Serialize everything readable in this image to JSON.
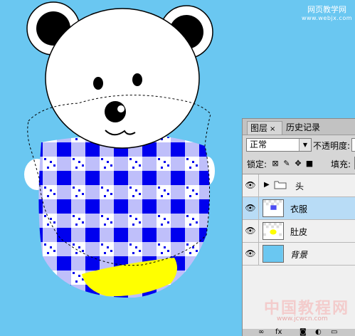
{
  "watermark_top": {
    "title": "网页教学网",
    "url": "www.webjx.com"
  },
  "watermark_bottom": {
    "cn": "中国教程网",
    "url": "www.jcwcn.com"
  },
  "panel": {
    "tabs": [
      {
        "label": "图层",
        "close": "×"
      },
      {
        "label": "历史记录"
      }
    ],
    "blend_mode": "正常",
    "opacity_label": "不透明度:",
    "lock_label": "锁定:",
    "fill_label": "填充:",
    "layers": [
      {
        "name": "头",
        "type": "group",
        "selected": false
      },
      {
        "name": "衣服",
        "type": "layer",
        "selected": true
      },
      {
        "name": "肚皮",
        "type": "layer",
        "selected": false
      },
      {
        "name": "背景",
        "type": "layer",
        "selected": false
      }
    ]
  },
  "colors": {
    "canvas_bg": "#6ac7f1",
    "shirt_blue": "#0000ee",
    "belly_yellow": "#ffff00",
    "selected_layer": "#b8dcf6"
  }
}
